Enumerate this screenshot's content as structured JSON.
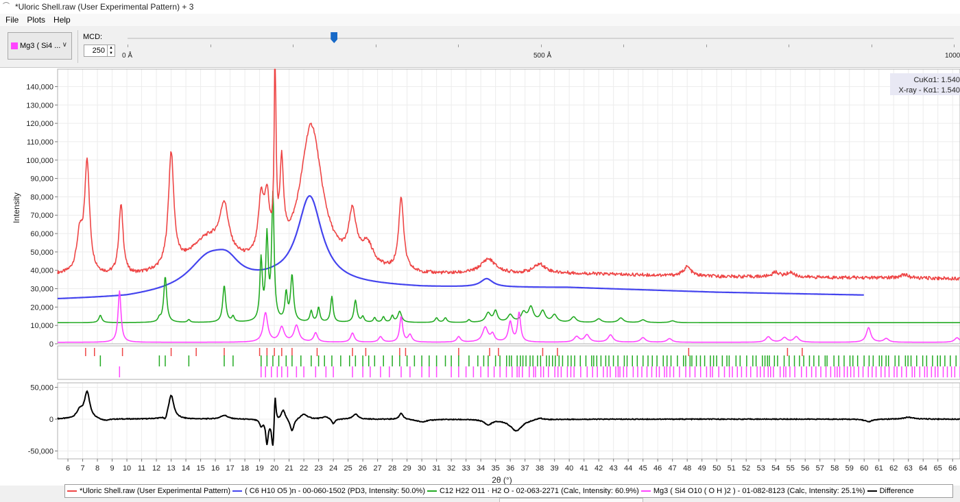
{
  "window": {
    "title": "*Uloric Shell.raw (User Experimental Pattern) + 3",
    "icon": "app-graph-icon"
  },
  "menu": [
    "File",
    "Plots",
    "Help"
  ],
  "toolbar": {
    "phase_select": {
      "value": "Mg3 ( Si4 ...",
      "color": "#ff44ff",
      "icon": "chevron-down-icon"
    },
    "mcd": {
      "label": "MCD:",
      "value": "250"
    },
    "slider": {
      "labels": [
        "0 Å",
        "500 Å",
        "1000"
      ],
      "value": 250,
      "max": 1000
    }
  },
  "instrument_labels": [
    "CuKα1: 1.540",
    "X-ray - Kα1: 1.540"
  ],
  "chart_data": {
    "type": "line",
    "ylabel": "Intensity",
    "xlabel": "2θ (°)",
    "xlim": [
      5.3,
      66.5
    ],
    "ylim": [
      0,
      148000
    ],
    "x_ticks": [
      6,
      7,
      8,
      9,
      10,
      11,
      12,
      13,
      14,
      15,
      16,
      17,
      18,
      19,
      20,
      21,
      22,
      23,
      24,
      25,
      26,
      27,
      28,
      29,
      30,
      31,
      32,
      33,
      34,
      35,
      36,
      37,
      38,
      39,
      40,
      41,
      42,
      43,
      44,
      45,
      46,
      47,
      48,
      49,
      50,
      51,
      52,
      53,
      54,
      55,
      56,
      57,
      58,
      59,
      60,
      61,
      62,
      63,
      64,
      65,
      66
    ],
    "y_ticks": [
      "0",
      "10,000",
      "20,000",
      "30,000",
      "40,000",
      "50,000",
      "60,000",
      "70,000",
      "80,000",
      "90,000",
      "100,000",
      "110,000",
      "120,000",
      "130,000",
      "140,000"
    ],
    "y_tick_values": [
      0,
      10000,
      20000,
      30000,
      40000,
      50000,
      60000,
      70000,
      80000,
      90000,
      100000,
      110000,
      120000,
      130000,
      140000
    ],
    "series": [
      {
        "name": "*Uloric Shell.raw (User Experimental Pattern)",
        "color": "#ee4444",
        "baseline": [
          [
            5.3,
            37000
          ],
          [
            10,
            35000
          ],
          [
            20,
            40000
          ],
          [
            30,
            37000
          ],
          [
            40,
            38000
          ],
          [
            50,
            36500
          ],
          [
            66.5,
            35500
          ]
        ],
        "peaks": [
          [
            6.8,
            20000,
            0.25
          ],
          [
            7.3,
            60000,
            0.2
          ],
          [
            9.6,
            38000,
            0.18
          ],
          [
            13,
            62000,
            0.22
          ],
          [
            15.5,
            18000,
            1.6
          ],
          [
            16.6,
            25000,
            0.35
          ],
          [
            19.1,
            30000,
            0.22
          ],
          [
            19.5,
            28000,
            0.2
          ],
          [
            20.05,
            108000,
            0.07
          ],
          [
            20.5,
            45000,
            0.15
          ],
          [
            22.5,
            78000,
            0.9
          ],
          [
            25.3,
            26000,
            0.3
          ],
          [
            26.3,
            12000,
            0.5
          ],
          [
            28.6,
            40000,
            0.2
          ],
          [
            34.5,
            8000,
            0.6
          ],
          [
            38,
            5000,
            0.5
          ],
          [
            48,
            5000,
            0.3
          ],
          [
            54,
            2500,
            0.3
          ],
          [
            55,
            2500,
            0.3
          ],
          [
            62.7,
            2000,
            0.3
          ]
        ]
      },
      {
        "name": "( C6 H10 O5 )n - 00-060-1502 (PD3, Intensity: 50.0%)",
        "color": "#4444ee",
        "x_end": 60,
        "baseline": [
          [
            5.3,
            24000
          ],
          [
            10,
            25000
          ],
          [
            20,
            33000
          ],
          [
            30,
            30500
          ],
          [
            40,
            30500
          ],
          [
            50,
            28000
          ],
          [
            60,
            26500
          ]
        ],
        "peaks": [
          [
            15.5,
            16000,
            1.6
          ],
          [
            16.8,
            9000,
            1.0
          ],
          [
            22.4,
            47000,
            1.0
          ],
          [
            34.4,
            4500,
            0.5
          ]
        ]
      },
      {
        "name": "C12 H22 O11 · H2 O - 02-063-2271 (Calc, Intensity: 60.9%)",
        "color": "#22aa22",
        "baseline": [
          [
            5.3,
            11500
          ],
          [
            66.5,
            11500
          ]
        ],
        "peaks": [
          [
            8.2,
            4000,
            0.12
          ],
          [
            12.2,
            2000,
            0.1
          ],
          [
            12.6,
            25000,
            0.12
          ],
          [
            14.2,
            1500,
            0.1
          ],
          [
            16.6,
            20000,
            0.12
          ],
          [
            17.2,
            3000,
            0.1
          ],
          [
            19.1,
            33000,
            0.1
          ],
          [
            19.5,
            45000,
            0.1
          ],
          [
            19.9,
            68000,
            0.1
          ],
          [
            20.8,
            15000,
            0.1
          ],
          [
            21.2,
            25000,
            0.12
          ],
          [
            22.5,
            6000,
            0.1
          ],
          [
            23,
            8000,
            0.1
          ],
          [
            23.9,
            14000,
            0.1
          ],
          [
            25.5,
            12000,
            0.12
          ],
          [
            26,
            3000,
            0.1
          ],
          [
            26.8,
            2500,
            0.1
          ],
          [
            27.4,
            3000,
            0.1
          ],
          [
            28,
            3500,
            0.1
          ],
          [
            28.5,
            6000,
            0.15
          ],
          [
            31,
            2500,
            0.12
          ],
          [
            31.6,
            2500,
            0.12
          ],
          [
            33.2,
            1500,
            0.1
          ],
          [
            34.5,
            5000,
            0.2
          ],
          [
            35,
            6000,
            0.15
          ],
          [
            36,
            4000,
            0.2
          ],
          [
            36.9,
            5000,
            0.2
          ],
          [
            37.4,
            8000,
            0.2
          ],
          [
            38.2,
            6000,
            0.2
          ],
          [
            39,
            4000,
            0.2
          ],
          [
            40.3,
            3000,
            0.2
          ],
          [
            42,
            2000,
            0.2
          ],
          [
            43.5,
            2500,
            0.2
          ],
          [
            45,
            1500,
            0.2
          ],
          [
            47,
            1000,
            0.2
          ]
        ]
      },
      {
        "name": "Mg3 ( Si4 O10 ( O H )2 ) - 01-082-8123 (Calc, Intensity: 25.1%)",
        "color": "#ff44ff",
        "baseline": [
          [
            5.3,
            800
          ],
          [
            66.5,
            800
          ]
        ],
        "peaks": [
          [
            9.5,
            28000,
            0.12
          ],
          [
            19.4,
            16000,
            0.18
          ],
          [
            20.5,
            8000,
            0.2
          ],
          [
            21.5,
            9000,
            0.2
          ],
          [
            22.8,
            5000,
            0.15
          ],
          [
            25.3,
            5000,
            0.15
          ],
          [
            27.2,
            3000,
            0.15
          ],
          [
            28.6,
            14000,
            0.12
          ],
          [
            29.2,
            4000,
            0.15
          ],
          [
            32.5,
            3000,
            0.15
          ],
          [
            34.3,
            8000,
            0.22
          ],
          [
            34.8,
            4000,
            0.15
          ],
          [
            36,
            11000,
            0.15
          ],
          [
            36.6,
            16000,
            0.12
          ],
          [
            40.5,
            3000,
            0.2
          ],
          [
            41.2,
            4000,
            0.2
          ],
          [
            42.8,
            4000,
            0.2
          ],
          [
            45,
            2500,
            0.2
          ],
          [
            46.8,
            2000,
            0.2
          ],
          [
            53.5,
            3000,
            0.2
          ],
          [
            54.6,
            2500,
            0.2
          ],
          [
            55.4,
            3000,
            0.2
          ],
          [
            60.3,
            8000,
            0.18
          ],
          [
            61.5,
            2000,
            0.2
          ],
          [
            66.3,
            2500,
            0.2
          ]
        ]
      }
    ],
    "difference": {
      "name": "Difference",
      "color": "#000000",
      "ylim": [
        -57000,
        57000
      ],
      "y_ticks": [
        "50,000",
        "0",
        "-50,000"
      ],
      "y_tick_values": [
        50000,
        0,
        -50000
      ],
      "baseline": [
        [
          5.3,
          0
        ],
        [
          66.5,
          0
        ]
      ],
      "peaks": [
        [
          6.8,
          12000,
          0.25
        ],
        [
          7.3,
          42000,
          0.22
        ],
        [
          13,
          38000,
          0.22
        ],
        [
          8.5,
          -3000,
          0.4
        ],
        [
          12.6,
          -8000,
          0.12
        ],
        [
          16.6,
          6000,
          0.3
        ],
        [
          19.1,
          -10000,
          0.12
        ],
        [
          19.5,
          -38000,
          0.1
        ],
        [
          19.9,
          -48000,
          0.1
        ],
        [
          20.05,
          48000,
          0.07
        ],
        [
          20.6,
          16000,
          0.15
        ],
        [
          21.2,
          -20000,
          0.15
        ],
        [
          22,
          8000,
          0.3
        ],
        [
          23.5,
          4000,
          0.3
        ],
        [
          24,
          -8000,
          0.15
        ],
        [
          25.5,
          8000,
          0.2
        ],
        [
          28.6,
          10000,
          0.15
        ],
        [
          30,
          -4000,
          0.5
        ],
        [
          34.5,
          -8000,
          0.3
        ],
        [
          36.4,
          -18000,
          0.5
        ],
        [
          38,
          3000,
          0.3
        ],
        [
          60.3,
          -4000,
          0.3
        ],
        [
          63,
          3000,
          0.4
        ]
      ]
    },
    "reference_ticks": [
      {
        "color": "#ee4444",
        "positions": [
          7.2,
          7.8,
          9.7,
          13,
          14.7,
          16.6,
          19,
          19.5,
          20,
          20.5,
          21.2,
          22.9,
          25.3,
          26.2,
          28.5,
          28.9,
          32.5,
          34.6,
          35.2,
          38.2,
          39.2,
          48.1,
          54.8,
          55.8
        ]
      },
      {
        "color": "#22aa22",
        "density_start": 24,
        "positions": [
          8.2,
          12.2,
          12.6,
          14.2,
          16.6,
          17.2,
          19.1,
          19.5,
          19.9,
          20.3,
          20.8,
          21.2,
          21.8,
          22.5,
          23,
          23.4,
          23.9,
          24.5,
          25.1,
          25.5,
          26,
          26.4,
          26.8,
          27.4,
          28,
          28.5,
          29,
          29.5,
          30,
          30.5,
          31,
          31.6,
          32,
          32.5,
          33.2,
          33.8,
          34.2,
          34.5,
          35
        ]
      },
      {
        "color": "#ff44ff",
        "density_start": 34.5,
        "positions": [
          9.5,
          19.1,
          19.4,
          19.8,
          20.2,
          20.5,
          20.9,
          21.5,
          22,
          22.8,
          23.5,
          24,
          25.3,
          26,
          26.5,
          27.2,
          27.8,
          28.6,
          29.2,
          30,
          30.5,
          31,
          32,
          32.5,
          33,
          33.5,
          34
        ]
      }
    ]
  },
  "legend": [
    {
      "label": "*Uloric Shell.raw (User Experimental Pattern)",
      "color": "#ee4444"
    },
    {
      "label": "( C6 H10 O5 )n - 00-060-1502 (PD3, Intensity: 50.0%)",
      "color": "#4444ee"
    },
    {
      "label": "C12 H22 O11 · H2 O - 02-063-2271 (Calc, Intensity: 60.9%)",
      "color": "#22aa22"
    },
    {
      "label": "Mg3 ( Si4 O10 ( O H )2 ) - 01-082-8123 (Calc, Intensity: 25.1%)",
      "color": "#ff44ff"
    },
    {
      "label": "Difference",
      "color": "#000000"
    }
  ]
}
